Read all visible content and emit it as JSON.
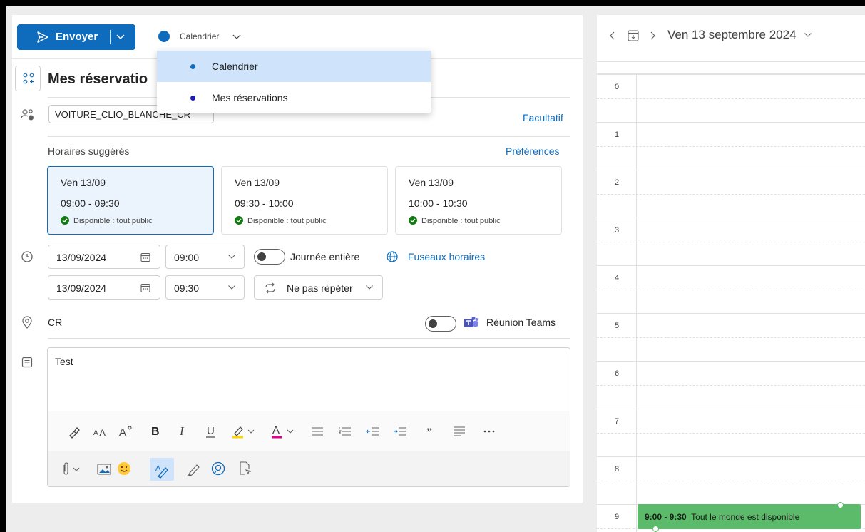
{
  "toolbar": {
    "send_label": "Envoyer",
    "calendar_label": "Calendrier"
  },
  "dropdown": {
    "items": [
      {
        "label": "Calendrier",
        "color": "#0f6cbd",
        "selected": true
      },
      {
        "label": "Mes réservations",
        "color": "#1b1db5",
        "selected": false
      }
    ]
  },
  "form": {
    "title": "Mes réservatio",
    "attendee_chip": "VOITURE_CLIO_BLANCHE_CR",
    "optional_link": "Facultatif",
    "suggested_label": "Horaires suggérés",
    "preferences_link": "Préférences",
    "slots": [
      {
        "day": "Ven 13/09",
        "time": "09:00 - 09:30",
        "availability": "Disponible : tout public",
        "selected": true
      },
      {
        "day": "Ven 13/09",
        "time": "09:30 - 10:00",
        "availability": "Disponible : tout public",
        "selected": false
      },
      {
        "day": "Ven 13/09",
        "time": "10:00 - 10:30",
        "availability": "Disponible : tout public",
        "selected": false
      }
    ],
    "start_date": "13/09/2024",
    "start_time": "09:00",
    "end_date": "13/09/2024",
    "end_time": "09:30",
    "all_day_label": "Journée entière",
    "timezones_link": "Fuseaux horaires",
    "repeat_label": "Ne pas répéter",
    "location": "CR",
    "teams_label": "Réunion Teams",
    "body_text": "Test"
  },
  "calendar": {
    "date_label": "Ven 13 septembre 2024",
    "hours": [
      "0",
      "1",
      "2",
      "3",
      "4",
      "5",
      "6",
      "7",
      "8",
      "9"
    ],
    "event": {
      "time": "9:00 - 9:30",
      "label": "Tout le monde est disponible",
      "color": "#5cbb6a"
    }
  },
  "colors": {
    "accent": "#0f6cbd",
    "available": "#107c10"
  }
}
